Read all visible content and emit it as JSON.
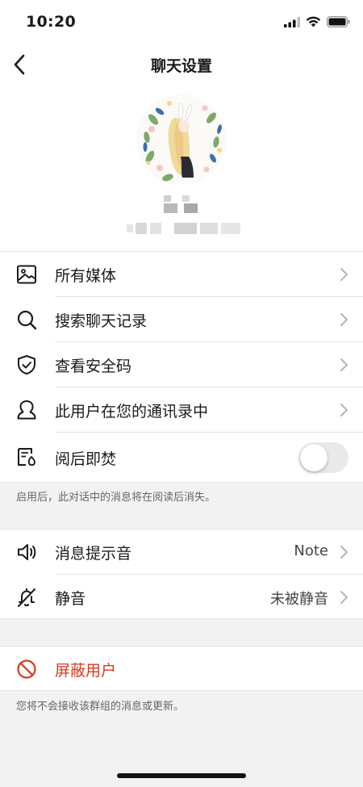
{
  "status_bar": {
    "time": "10:20"
  },
  "nav": {
    "title": "聊天设置"
  },
  "menu": {
    "all_media": "所有媒体",
    "search_history": "搜索聊天记录",
    "safety_code": "查看安全码",
    "in_contacts": "此用户在您的通讯录中",
    "burn_after_read": "阅后即焚"
  },
  "burn_note": "启用后，此对话中的消息将在阅读后消失。",
  "notifications": {
    "sound_label": "消息提示音",
    "sound_value": "Note",
    "mute_label": "静音",
    "mute_value": "未被静音"
  },
  "block": {
    "label": "屏蔽用户",
    "note": "您将不会接收该群组的消息或更新。"
  },
  "colors": {
    "danger": "#d9391f",
    "toggle_off": "#e9e9ea"
  },
  "toggle_state": {
    "burn_after_read": false
  }
}
